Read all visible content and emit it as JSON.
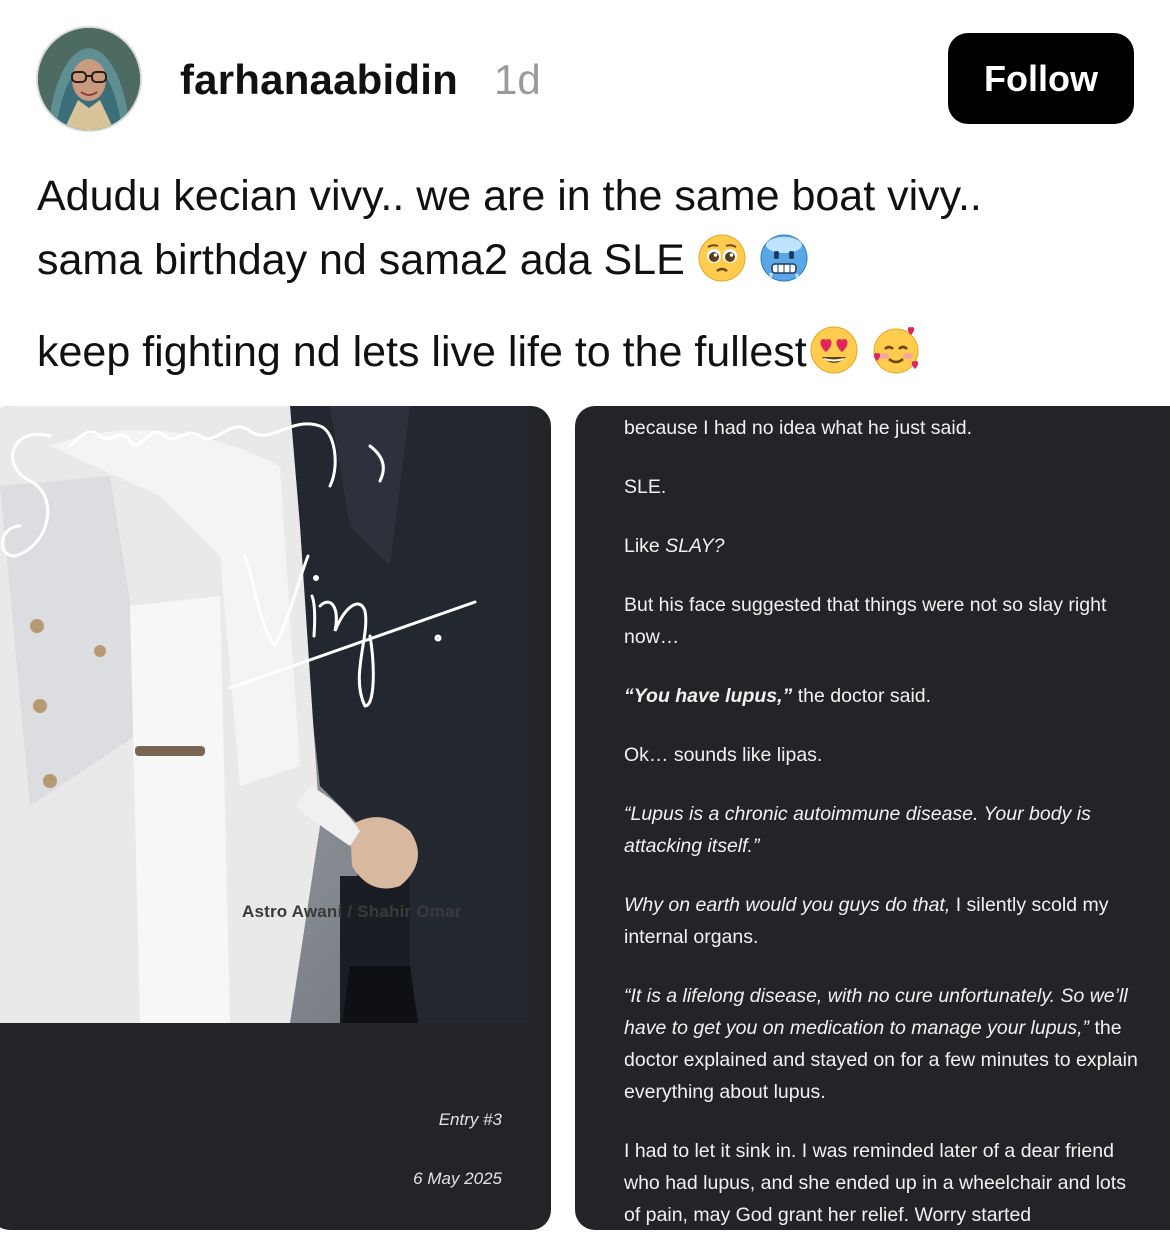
{
  "post": {
    "username": "farhanaabidin",
    "time": "1d",
    "follow_label": "Follow",
    "text_line1": "Adudu kecian vivy.. we are in the same boat vivy..",
    "text_line2": "sama birthday nd sama2 ada SLE",
    "text_line3": "keep fighting nd lets live life to the fullest",
    "emojis": [
      "pleading-face",
      "cold-face",
      "heart-eyes-face",
      "smiling-face-with-hearts"
    ]
  },
  "slide1": {
    "signature": "Sincerely, Vivy.",
    "photo_credit": "Astro Awani / Shahir Omar",
    "entry": "Entry #3",
    "date": "6 May 2025"
  },
  "slide2": {
    "p1": "because I had no idea what he just said.",
    "p2": "SLE.",
    "p3_plain": "Like ",
    "p3_italic": "SLAY?",
    "p4": "But his face suggested that things were not so slay right now…",
    "p5_bold_italic": "“You have lupus,”",
    "p5_plain": " the doctor said.",
    "p6": "Ok… sounds like lipas.",
    "p7_italic": "“Lupus is a chronic autoimmune disease. Your body is attacking itself.”",
    "p8_italic": "Why on earth would you guys do that,",
    "p8_plain": " I silently scold my internal organs.",
    "p9_italic": "“It is a lifelong disease, with no cure unfortunately. So we’ll have to get you on medication to manage your lupus,”",
    "p9_plain": " the doctor explained and stayed on for a few minutes to explain everything about lupus.",
    "p10": "I had to let it sink in. I was reminded later of a dear friend who had lupus, and she ended up in a wheelchair and lots of pain, may God grant her relief. Worry started"
  }
}
